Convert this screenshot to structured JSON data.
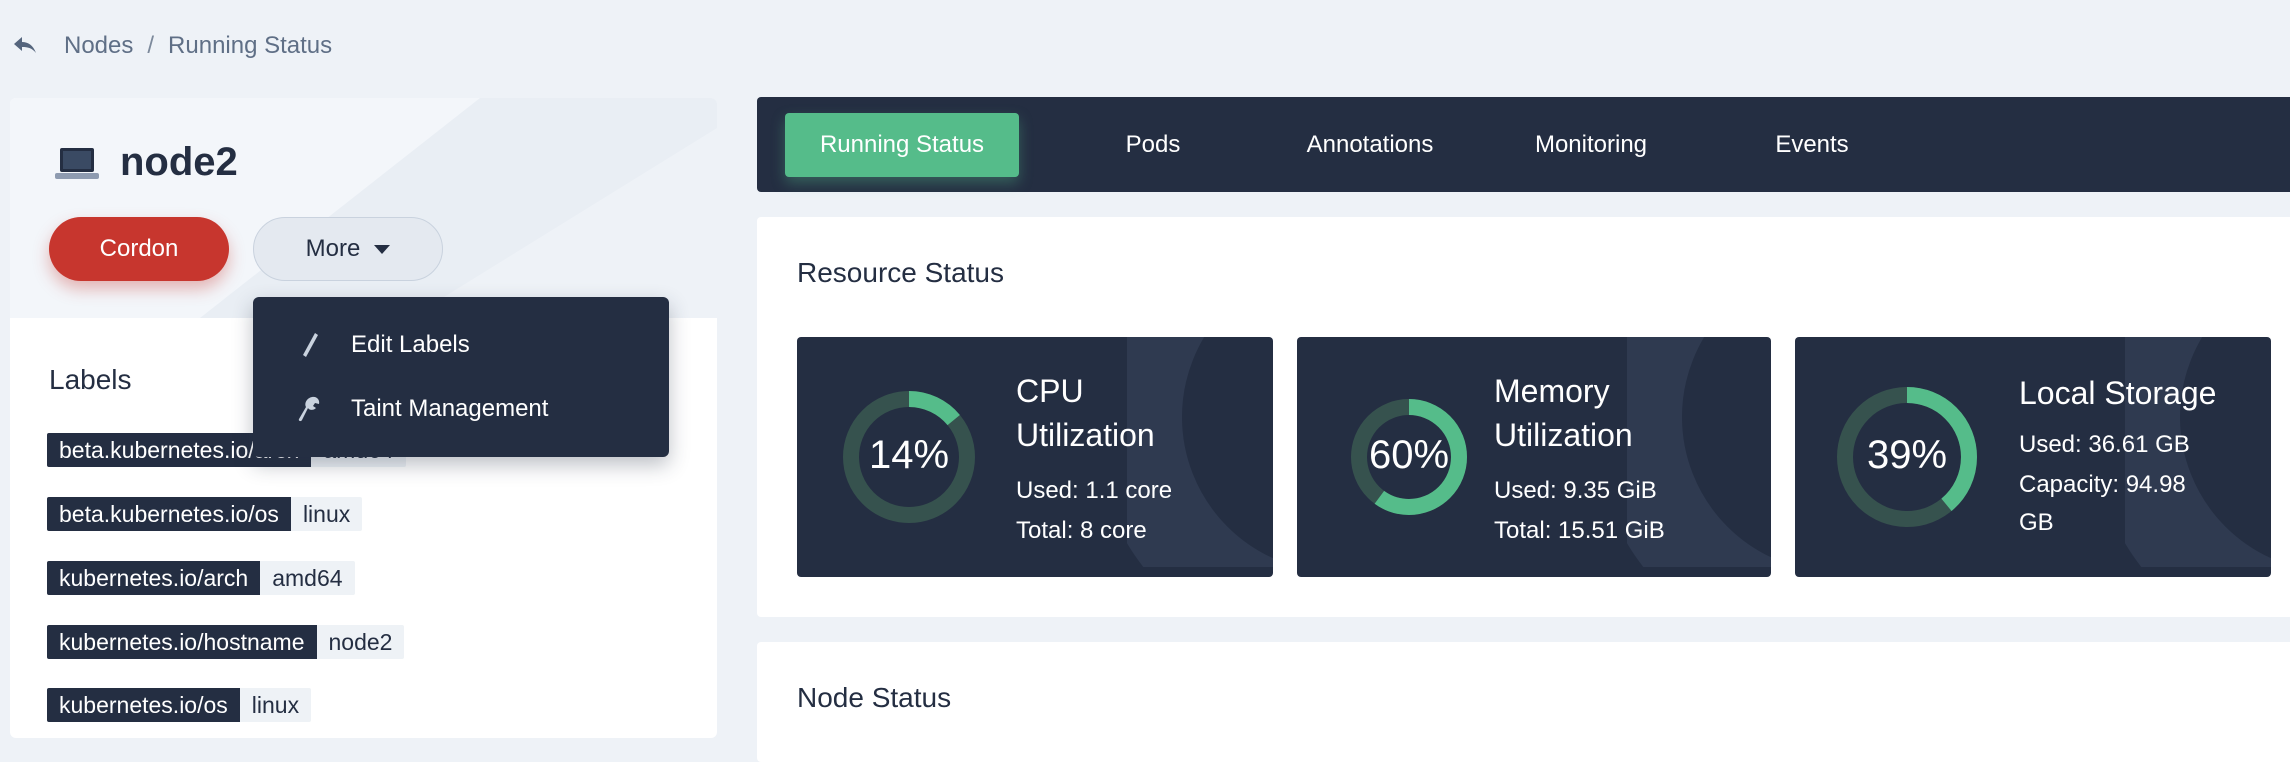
{
  "breadcrumb": {
    "items": [
      "Nodes",
      "Running Status"
    ],
    "separator": "/"
  },
  "node": {
    "name": "node2"
  },
  "actions": {
    "cordon": "Cordon",
    "more": "More"
  },
  "more_menu": {
    "items": [
      {
        "label": "Edit Labels",
        "icon": "pencil-icon"
      },
      {
        "label": "Taint Management",
        "icon": "wrench-icon"
      }
    ]
  },
  "labels": {
    "title": "Labels",
    "items": [
      {
        "key": "beta.kubernetes.io/arch",
        "value": "amd64"
      },
      {
        "key": "beta.kubernetes.io/os",
        "value": "linux"
      },
      {
        "key": "kubernetes.io/arch",
        "value": "amd64"
      },
      {
        "key": "kubernetes.io/hostname",
        "value": "node2"
      },
      {
        "key": "kubernetes.io/os",
        "value": "linux"
      }
    ]
  },
  "tabs": [
    "Running Status",
    "Pods",
    "Annotations",
    "Monitoring",
    "Events"
  ],
  "active_tab": "Running Status",
  "resource": {
    "title": "Resource Status",
    "cards": [
      {
        "title_line1": "CPU",
        "title_line2": "Utilization",
        "percent_label": "14%",
        "percent": 14,
        "line1": "Used: 1.1 core",
        "line2": "Total: 8 core"
      },
      {
        "title_line1": "Memory",
        "title_line2": "Utilization",
        "percent_label": "60%",
        "percent": 60,
        "line1": "Used: 9.35 GiB",
        "line2": "Total: 15.51 GiB"
      },
      {
        "title_line1": "Local Storage",
        "percent_label": "39%",
        "percent": 39,
        "line1": "Used: 36.61 GB",
        "line2": "Capacity: 94.98",
        "line3": "GB"
      }
    ]
  },
  "node_status": {
    "title": "Node Status"
  },
  "colors": {
    "dark": "#242e42",
    "accent_green": "#55bc8a",
    "danger": "#c7362e",
    "ring_track": "#36524e"
  }
}
